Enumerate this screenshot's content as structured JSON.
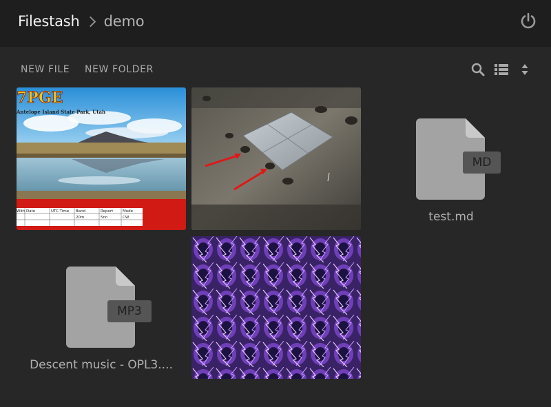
{
  "breadcrumb": {
    "root": "Filestash",
    "current": "demo"
  },
  "toolbar": {
    "new_file": "NEW FILE",
    "new_folder": "NEW FOLDER"
  },
  "icons": {
    "power": "power-icon",
    "search": "search-icon",
    "list_view": "list-view-icon",
    "sort": "sort-icon"
  },
  "files": [
    {
      "kind": "image",
      "thumb": "postcard"
    },
    {
      "kind": "image",
      "thumb": "ground-photo"
    },
    {
      "kind": "document",
      "name": "test.md",
      "ext": "MD"
    },
    {
      "kind": "document",
      "name": "Descent music - OPL3....",
      "ext": "MP3"
    },
    {
      "kind": "image",
      "thumb": "purple-lightning"
    }
  ],
  "postcard": {
    "callsign": "7PGE",
    "location": "Antelope Island State Park, Utah",
    "table_headers": [
      "With",
      "Date",
      "UTC Time",
      "Band",
      "Report",
      "Mode"
    ],
    "table_row": [
      "",
      "",
      "",
      "20m",
      "5nn",
      "CW"
    ]
  },
  "colors": {
    "background": "#1e1e1e",
    "panel": "#272727",
    "doc_icon": "#a3a3a3",
    "ext_badge": "#555555"
  }
}
